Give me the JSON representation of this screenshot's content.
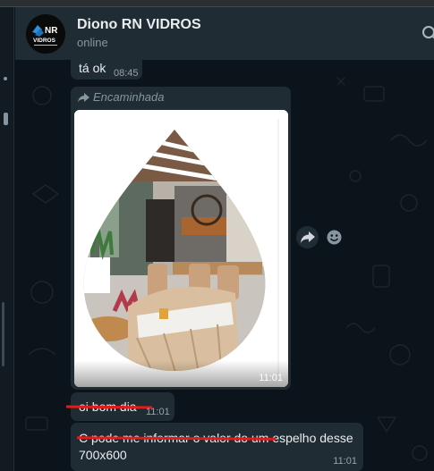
{
  "header": {
    "title": "Diono RN VIDROS",
    "status": "online",
    "avatar_text_top": "NR",
    "avatar_text_bottom": "VIDROS",
    "search_icon": "search-icon"
  },
  "messages": [
    {
      "kind": "text",
      "text": "tá ok",
      "time": "08:45"
    },
    {
      "kind": "image",
      "forwarded_label": "Encaminhada",
      "time": "11:01",
      "image_subject": "interior-room-photo"
    },
    {
      "kind": "text",
      "text": "oi bom dia",
      "time": "11:01",
      "struck": true
    },
    {
      "kind": "text",
      "text": "C pode me informar o valor do um espelho desse 700x600",
      "time": "11:01",
      "struck_part": "C pode me informar o valor do um"
    }
  ],
  "hover_actions": {
    "forward_icon": "share-arrow-icon",
    "react_icon": "emoji-icon"
  },
  "colors": {
    "panel": "#202c33",
    "chat_bg": "#0b141a",
    "text": "#e9edef",
    "muted": "#8696a0",
    "strike": "#e21b1b"
  }
}
